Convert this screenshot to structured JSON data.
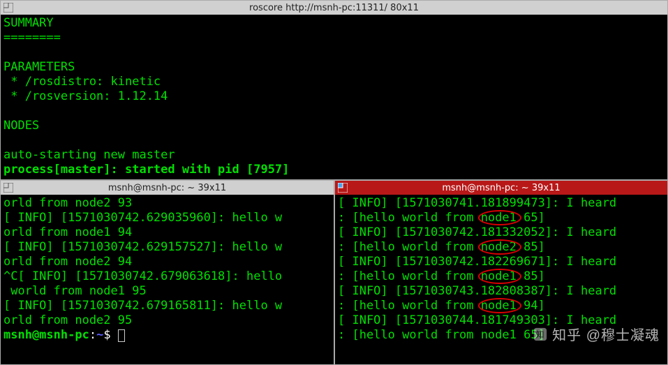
{
  "top": {
    "title": "roscore http://msnh-pc:11311/ 80x11",
    "lines": [
      {
        "t": "SUMMARY",
        "cls": ""
      },
      {
        "t": "========",
        "cls": ""
      },
      {
        "t": "",
        "cls": ""
      },
      {
        "t": "PARAMETERS",
        "cls": ""
      },
      {
        "t": " * /rosdistro: kinetic",
        "cls": ""
      },
      {
        "t": " * /rosversion: 1.12.14",
        "cls": ""
      },
      {
        "t": "",
        "cls": ""
      },
      {
        "t": "NODES",
        "cls": ""
      },
      {
        "t": "",
        "cls": ""
      },
      {
        "t": "auto-starting new master",
        "cls": ""
      },
      {
        "t": "process[master]: started with pid [7957]",
        "cls": "bold"
      }
    ]
  },
  "left": {
    "title": "msnh@msnh-pc: ~ 39x11",
    "lines": [
      "orld from node2 93",
      "[ INFO] [1571030742.629035960]: hello w",
      "orld from node1 94",
      "[ INFO] [1571030742.629157527]: hello w",
      "orld from node2 94",
      "^C[ INFO] [1571030742.679063618]: hello",
      " world from node1 95",
      "[ INFO] [1571030742.679165811]: hello w",
      "orld from node2 95"
    ],
    "prompt_user": "msnh@msnh-pc",
    "prompt_sep": ":",
    "prompt_path": "~",
    "prompt_sym": "$ "
  },
  "right": {
    "title": "msnh@msnh-pc: ~ 39x11",
    "lines": [
      "[ INFO] [1571030741.181899473]: I heard",
      ": [hello world from node1 65]",
      "[ INFO] [1571030742.181332052]: I heard",
      ": [hello world from node2 85]",
      "[ INFO] [1571030742.182269671]: I heard",
      ": [hello world from node1 85]",
      "[ INFO] [1571030743.182808387]: I heard",
      ": [hello world from node1 94]",
      "[ INFO] [1571030744.181749303]: I heard",
      ": [hello world from node1 65]"
    ]
  },
  "watermark": "知乎 @穆士凝魂",
  "annotations": [
    {
      "word": "node1",
      "line_idx": 1
    },
    {
      "word": "node2",
      "line_idx": 3
    },
    {
      "word": "node1",
      "line_idx": 5
    },
    {
      "word": "node1",
      "line_idx": 7
    }
  ]
}
